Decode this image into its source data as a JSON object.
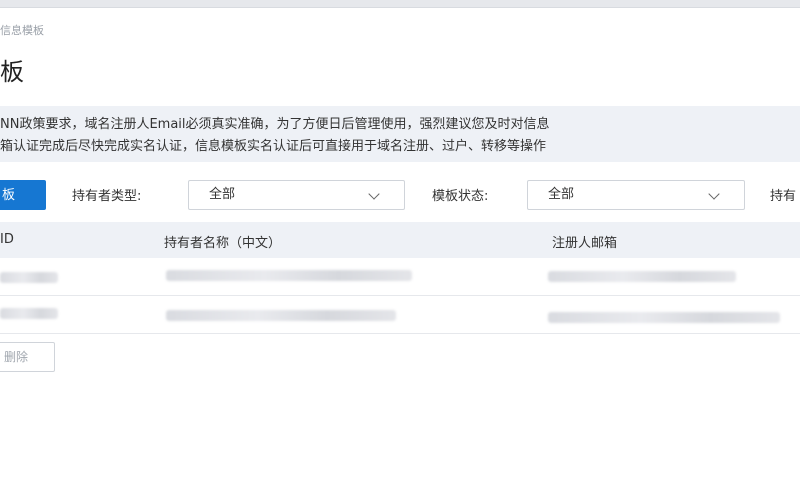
{
  "breadcrumb": "信息模板",
  "page_title": "板",
  "notice": {
    "line1": "NN政策要求，域名注册人Email必须真实准确，为了方便日后管理使用，强烈建议您及时对信息",
    "line2": "箱认证完成后尽快完成实名认证，信息模板实名认证后可直接用于域名注册、过户、转移等操作"
  },
  "toolbar": {
    "create_label": "板",
    "holder_type_label": "持有者类型:",
    "holder_type_value": "全部",
    "template_status_label": "模板状态:",
    "template_status_value": "全部",
    "third_filter_label": "持有"
  },
  "table": {
    "columns": [
      "ID",
      "持有者名称（中文）",
      "注册人邮箱"
    ]
  },
  "footer": {
    "delete_label": "删除"
  }
}
